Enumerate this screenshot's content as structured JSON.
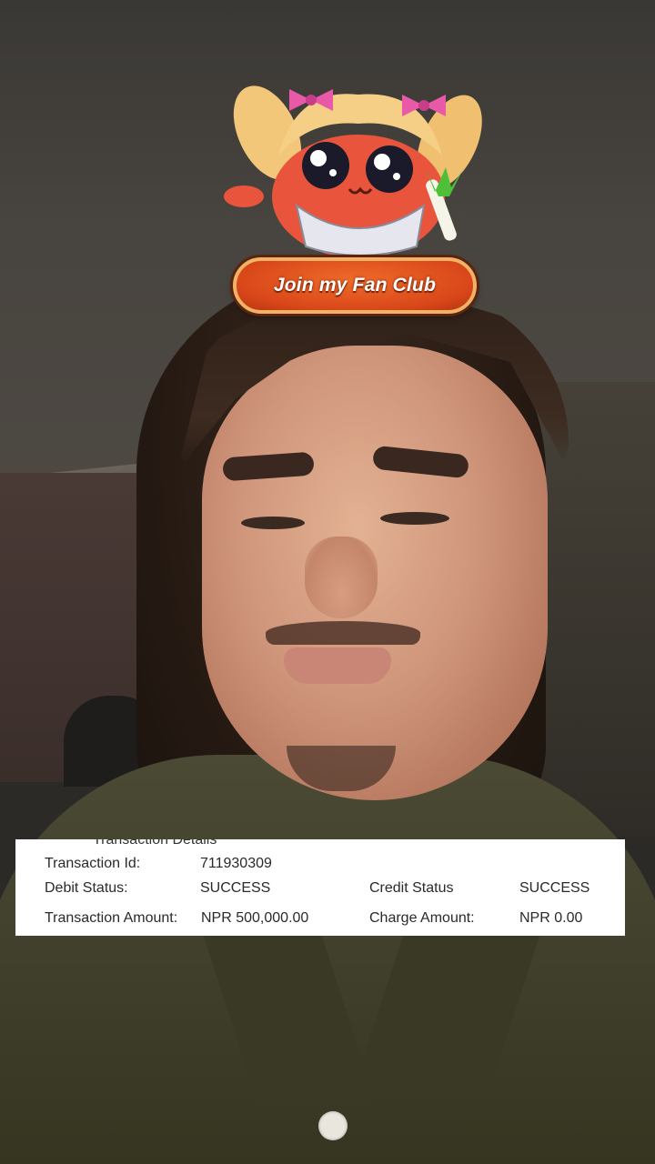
{
  "effect": {
    "mascot_icon": "fan-club-mascot-icon",
    "fan_club_button": "Join my Fan Club"
  },
  "transaction": {
    "title": "Transaction Details",
    "id_label": "Transaction Id:",
    "id_value": "711930309",
    "debit_label": "Debit Status:",
    "debit_value": "SUCCESS",
    "credit_label": "Credit Status",
    "credit_value": "SUCCESS",
    "amount_label": "Transaction Amount:",
    "amount_value": "NPR 500,000.00",
    "charge_label": "Charge Amount:",
    "charge_value": "NPR 0.00"
  },
  "colors": {
    "button_orange": "#e0501e",
    "button_border": "#f2b266",
    "card_background": "#ffffff"
  }
}
